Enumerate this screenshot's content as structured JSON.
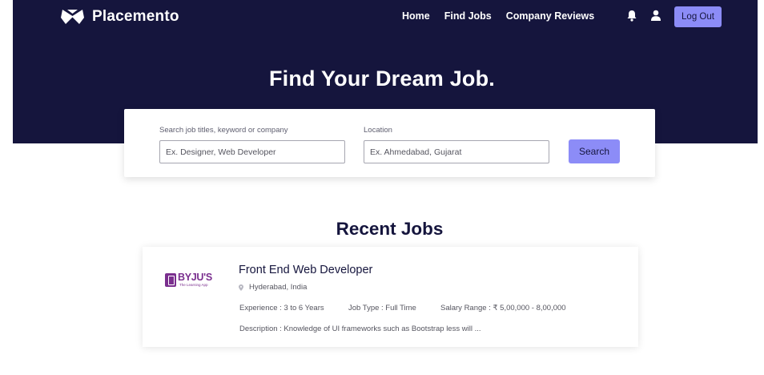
{
  "brand": {
    "name": "Placemento",
    "icon": "collar-logo-icon"
  },
  "nav": {
    "links": [
      "Home",
      "Find Jobs",
      "Company Reviews"
    ],
    "icons": [
      "bell-icon",
      "user-icon"
    ],
    "logout_label": "Log Out"
  },
  "hero": {
    "title": "Find Your Dream Job."
  },
  "search": {
    "keyword_label": "Search job titles, keyword or company",
    "keyword_placeholder": "Ex. Designer, Web Developer",
    "location_label": "Location",
    "location_placeholder": "Ex. Ahmedabad, Gujarat",
    "button_label": "Search"
  },
  "recent": {
    "title": "Recent Jobs",
    "jobs": [
      {
        "company_logo_text": "BYJU'S",
        "company_logo_subtext": "The Learning App",
        "title": "Front End Web Developer",
        "location": "Hyderabad, India",
        "experience": "Experience : 3 to 6 Years",
        "job_type": "Job Type : Full Time",
        "salary": "Salary Range : ₹ 5,00,000 - 8,00,000",
        "description": "Description : Knowledge of UI frameworks such as Bootstrap less will ..."
      }
    ]
  },
  "colors": {
    "navy": "#15153d",
    "accent": "#8c8cf7",
    "byjus_purple": "#7a2f8e"
  }
}
